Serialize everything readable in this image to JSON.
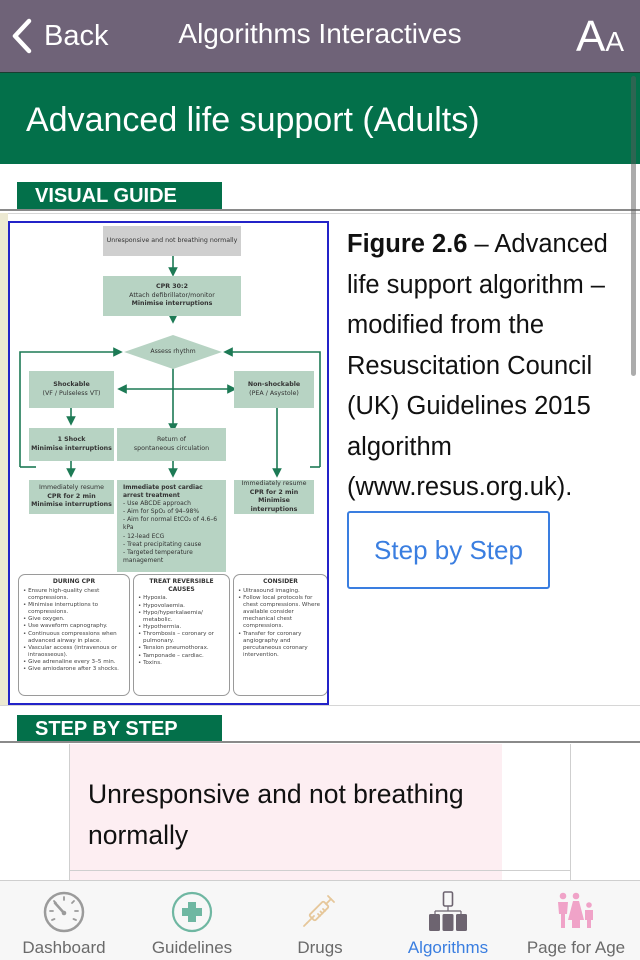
{
  "navbar": {
    "back_label": "Back",
    "title": "Algorithms Interactives",
    "font_size_big": "A",
    "font_size_small": "A"
  },
  "page": {
    "title": "Advanced life support (Adults)",
    "theme_color": "#03704a",
    "nav_color": "#6f6378"
  },
  "visual_guide": {
    "section_label": "VISUAL GUIDE",
    "figure": {
      "start": "Unresponsive and not breathing normally",
      "cpr_title": "CPR 30:2",
      "cpr_line2": "Attach defibrillator/monitor",
      "cpr_line3": "Minimise interruptions",
      "assess": "Assess rhythm",
      "shockable_title": "Shockable",
      "shockable_sub": "(VF / Pulseless VT)",
      "nonshockable_title": "Non-shockable",
      "nonshockable_sub": "(PEA / Asystole)",
      "shock_title": "1 Shock",
      "shock_sub": "Minimise interruptions",
      "rosc_line1": "Return of",
      "rosc_line2": "spontaneous circulation",
      "resume_line1": "Immediately resume",
      "resume_line2": "CPR for 2 min",
      "resume_line3": "Minimise interruptions",
      "post_title": "Immediate post cardiac arrest treatment",
      "post_items": [
        "- Use ABCDE approach",
        "- Aim for SpO₂ of 94–98%",
        "- Aim for normal EtCO₂ of 4.6–6 kPa",
        "- 12-lead ECG",
        "- Treat precipitating cause",
        "- Targeted temperature management"
      ],
      "panels": [
        {
          "heading": "DURING CPR",
          "items": [
            "Ensure high-quality chest compressions.",
            "Minimise interruptions to compressions.",
            "Give oxygen.",
            "Use waveform capnography.",
            "Continuous compressions when advanced airway in place.",
            "Vascular access (intravenous or intraosseous).",
            "Give adrenaline every 3–5 min.",
            "Give amiodarone after 3 shocks."
          ]
        },
        {
          "heading": "TREAT REVERSIBLE CAUSES",
          "items": [
            "Hypoxia.",
            "Hypovolaemia.",
            "Hypo/hyperkalaemia/ metabolic.",
            "Hypothermia.",
            "Thrombosis – coronary or pulmonary.",
            "Tension pneumothorax.",
            "Tamponade – cardiac.",
            "Toxins."
          ]
        },
        {
          "heading": "CONSIDER",
          "items": [
            "Ultrasound imaging.",
            "Follow local protocols for chest compressions. Where available consider mechanical chest compressions.",
            "Transfer for coronary angiography and percutaneous coronary intervention."
          ]
        }
      ]
    },
    "caption_bold": "Figure 2.6",
    "caption_rest": " – Advanced life support algorithm – modified from the Resuscitation Council (UK) Guidelines 2015 algorithm (www.resus.org.uk).",
    "step_button_label": "Step by Step"
  },
  "step_by_step": {
    "section_label": "STEP BY STEP",
    "current_step_text": "Unresponsive and not breathing normally"
  },
  "tabbar": {
    "items": [
      {
        "label": "Dashboard",
        "icon": "gauge-icon",
        "active": false
      },
      {
        "label": "Guidelines",
        "icon": "medical-cross-icon",
        "active": false
      },
      {
        "label": "Drugs",
        "icon": "syringe-icon",
        "active": false
      },
      {
        "label": "Algorithms",
        "icon": "flowchart-icon",
        "active": true
      },
      {
        "label": "Page for Age",
        "icon": "family-icon",
        "active": false
      }
    ],
    "active_color": "#3a7ee0"
  }
}
